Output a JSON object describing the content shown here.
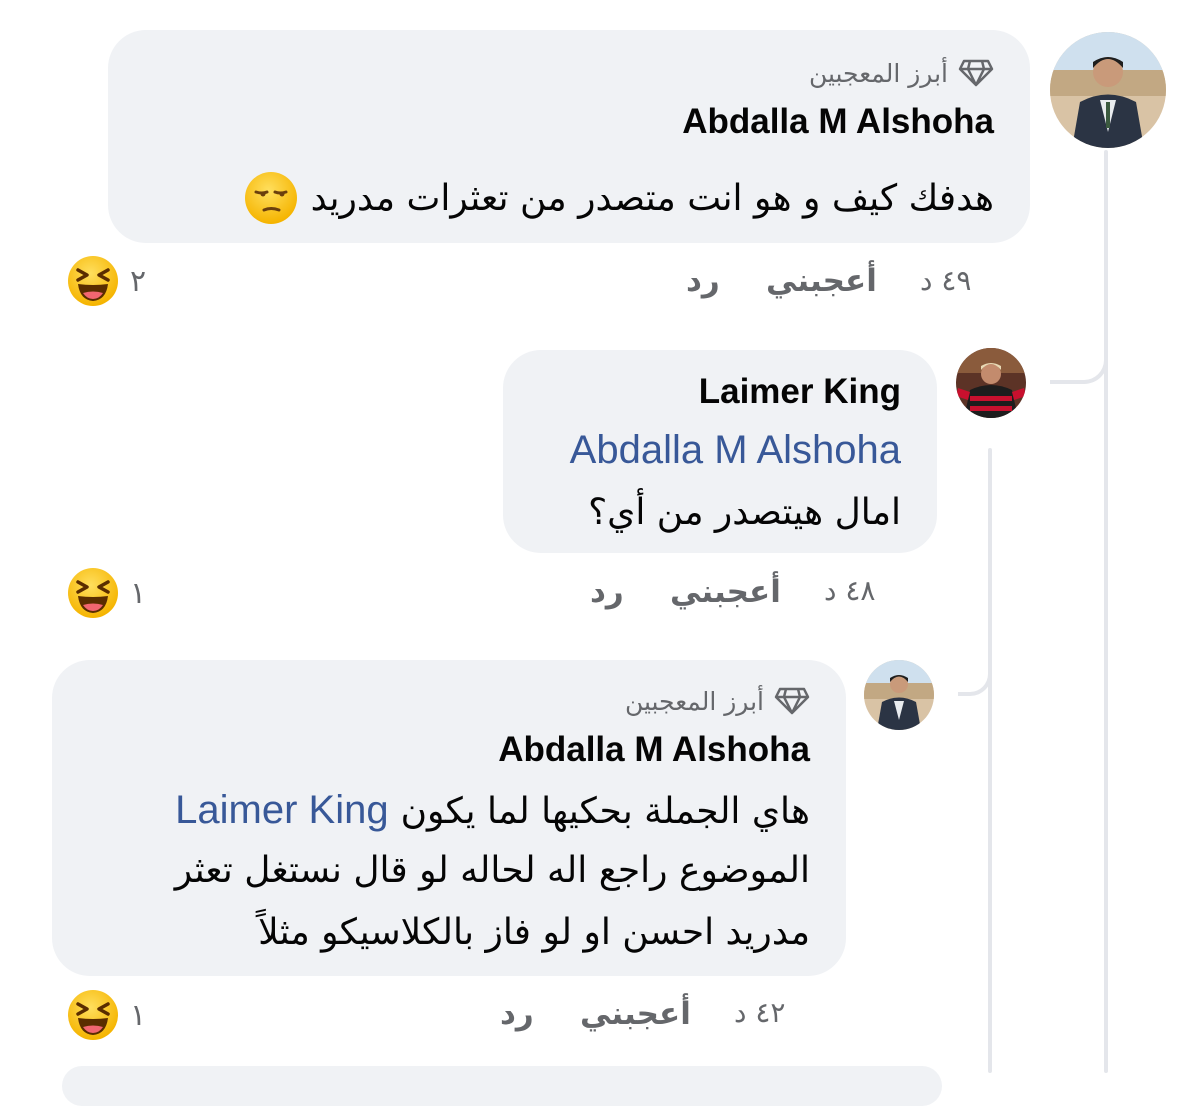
{
  "comments": [
    {
      "badge": "أبرز المعجبين",
      "author": "Abdalla M Alshoha",
      "text": "هدفك كيف و هو انت متصدر من تعثرات مدريد",
      "emoji": "unamused-face",
      "time": "٤٩ د",
      "like": "أعجبني",
      "reply": "رد",
      "reaction_count": "٢",
      "reaction": "laughing-face"
    },
    {
      "author": "Laimer King",
      "mention": "Abdalla M Alshoha",
      "text": "امال هيتصدر من أي؟",
      "time": "٤٨ د",
      "like": "أعجبني",
      "reply": "رد",
      "reaction_count": "١",
      "reaction": "laughing-face"
    },
    {
      "badge": "أبرز المعجبين",
      "author": "Abdalla M Alshoha",
      "mention": "Laimer King",
      "line1": "هاي الجملة بحكيها لما يكون",
      "line2": "الموضوع راجع اله لحاله لو قال نستغل تعثر",
      "line3": "مدريد احسن او لو فاز بالكلاسيكو مثلاً",
      "time": "٤٢ د",
      "like": "أعجبني",
      "reply": "رد",
      "reaction_count": "١",
      "reaction": "laughing-face"
    }
  ],
  "colors": {
    "bubble": "#f0f2f5",
    "mention": "#385898",
    "meta": "#65676b",
    "thread_line": "#e4e6eb"
  }
}
